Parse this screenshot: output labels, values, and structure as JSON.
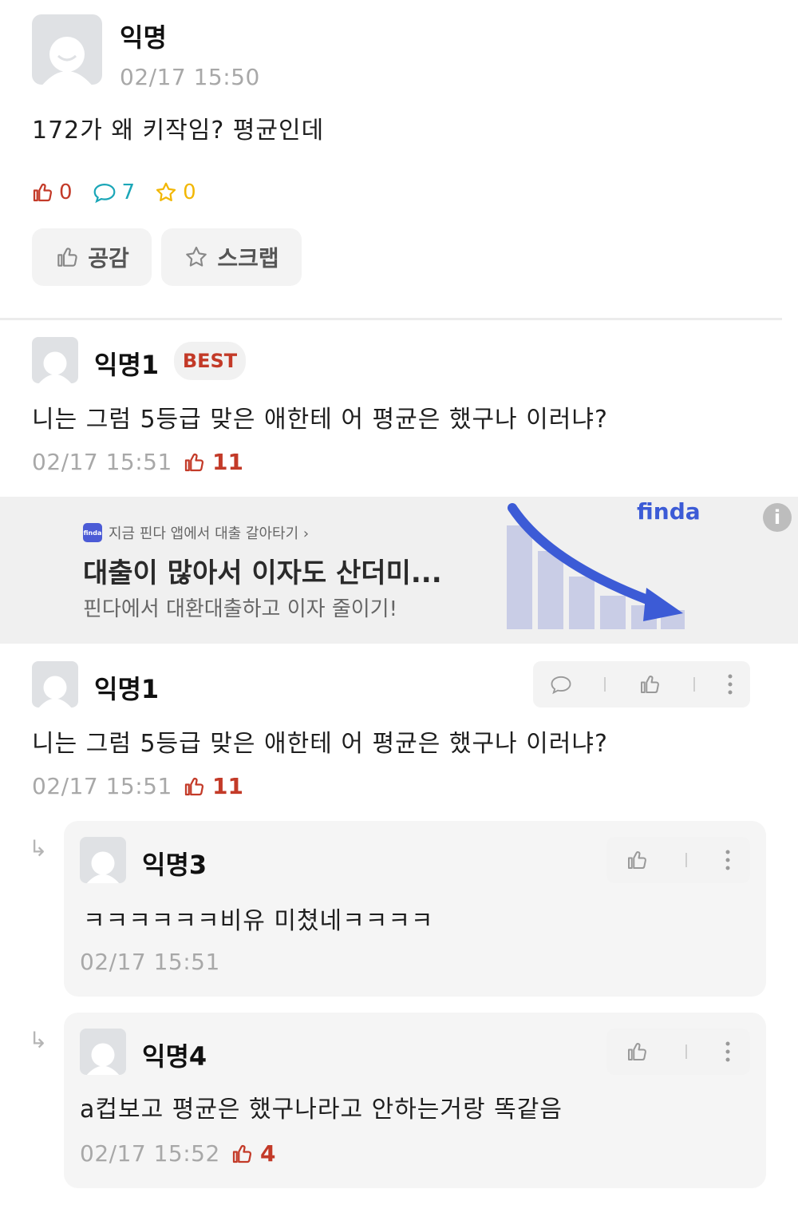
{
  "post": {
    "author": "익명",
    "time": "02/17 15:50",
    "content": "172가 왜 키작임? 평균인데",
    "like_count": "0",
    "comment_count": "7",
    "scrap_count": "0",
    "like_button": "공감",
    "scrap_button": "스크랩"
  },
  "best_comment": {
    "author": "익명1",
    "badge": "BEST",
    "content": "니는 그럼 5등급 맞은 애한테 어 평균은 했구나 이러냐?",
    "time": "02/17 15:51",
    "likes": "11"
  },
  "ad": {
    "source": "지금 핀다 앱에서 대출 갈아타기 ›",
    "logo_text": "finda",
    "title": "대출이 많아서 이자도 산더미...",
    "subtitle": "핀다에서 대환대출하고 이자 줄이기!",
    "brand": "finda",
    "info": "i"
  },
  "comment": {
    "author": "익명1",
    "content": "니는 그럼 5등급 맞은 애한테 어 평균은 했구나 이러냐?",
    "time": "02/17 15:51",
    "likes": "11"
  },
  "replies": [
    {
      "author": "익명3",
      "content": "ㅋㅋㅋㅋㅋㅋ비유 미쳤네ㅋㅋㅋㅋ",
      "time": "02/17 15:51",
      "likes": ""
    },
    {
      "author": "익명4",
      "content": "a컵보고 평균은 했구나라고 안하는거랑 똑같음",
      "time": "02/17 15:52",
      "likes": "4"
    }
  ],
  "colors": {
    "like_red": "#c33a28",
    "comment_teal": "#1aa6b7",
    "scrap_yellow": "#f2b705",
    "ad_blue": "#3c5bd6"
  }
}
